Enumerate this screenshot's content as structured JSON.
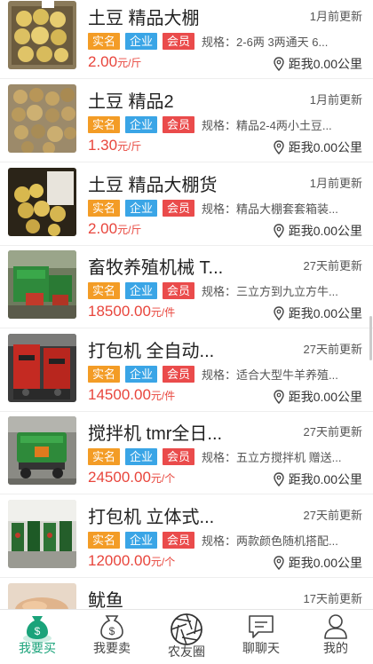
{
  "listings": [
    {
      "title": "土豆 精品大棚",
      "time": "1月前更新",
      "tags": [
        "实名",
        "企业",
        "会员"
      ],
      "spec": "规格：2-6两  3两通天  6...",
      "price": "2.00",
      "unit": "元/斤",
      "distance": "距我0.00公里",
      "image": "potatoes-crate"
    },
    {
      "title": "土豆 精品2",
      "time": "1月前更新",
      "tags": [
        "实名",
        "企业",
        "会员"
      ],
      "spec": "规格：精品2-4两小土豆...",
      "price": "1.30",
      "unit": "元/斤",
      "distance": "距我0.00公里",
      "image": "potatoes-sacks"
    },
    {
      "title": "土豆 精品大棚货",
      "time": "1月前更新",
      "tags": [
        "实名",
        "企业",
        "会员"
      ],
      "spec": "规格：精品大棚套套箱装...",
      "price": "2.00",
      "unit": "元/斤",
      "distance": "距我0.00公里",
      "image": "potatoes-box"
    },
    {
      "title": "畜牧养殖机械 T...",
      "time": "27天前更新",
      "tags": [
        "实名",
        "企业",
        "会员"
      ],
      "spec": "规格：三立方到九立方牛...",
      "price": "18500.00",
      "unit": "元/件",
      "distance": "距我0.00公里",
      "image": "green-machine"
    },
    {
      "title": "打包机 全自动...",
      "time": "27天前更新",
      "tags": [
        "实名",
        "企业",
        "会员"
      ],
      "spec": "规格：适合大型牛羊养殖...",
      "price": "14500.00",
      "unit": "元/件",
      "distance": "距我0.00公里",
      "image": "red-baler"
    },
    {
      "title": "搅拌机 tmr全日...",
      "time": "27天前更新",
      "tags": [
        "实名",
        "企业",
        "会员"
      ],
      "spec": "规格：五立方搅拌机 赠送...",
      "price": "24500.00",
      "unit": "元/个",
      "distance": "距我0.00公里",
      "image": "mixer"
    },
    {
      "title": "打包机 立体式...",
      "time": "27天前更新",
      "tags": [
        "实名",
        "企业",
        "会员"
      ],
      "spec": "规格：两款颜色随机搭配...",
      "price": "12000.00",
      "unit": "元/个",
      "distance": "距我0.00公里",
      "image": "baler-lineup"
    },
    {
      "title": "鱿鱼",
      "time": "17天前更新",
      "tags": [],
      "spec": "",
      "price": "",
      "unit": "",
      "distance": "",
      "image": "squid"
    }
  ],
  "tabbar": [
    {
      "label": "我要买",
      "icon": "money-bag-icon",
      "active": true
    },
    {
      "label": "我要卖",
      "icon": "money-bag-outline-icon",
      "active": false
    },
    {
      "label": "农友圈",
      "icon": "aperture-icon",
      "active": false
    },
    {
      "label": "聊聊天",
      "icon": "chat-bubble-icon",
      "active": false
    },
    {
      "label": "我的",
      "icon": "person-icon",
      "active": false
    }
  ],
  "colors": {
    "price": "#e8453c",
    "tag_real": "#f39c26",
    "tag_biz": "#3aa5e6",
    "tag_vip": "#ea4b4b",
    "active_tab": "#1aa37a"
  }
}
